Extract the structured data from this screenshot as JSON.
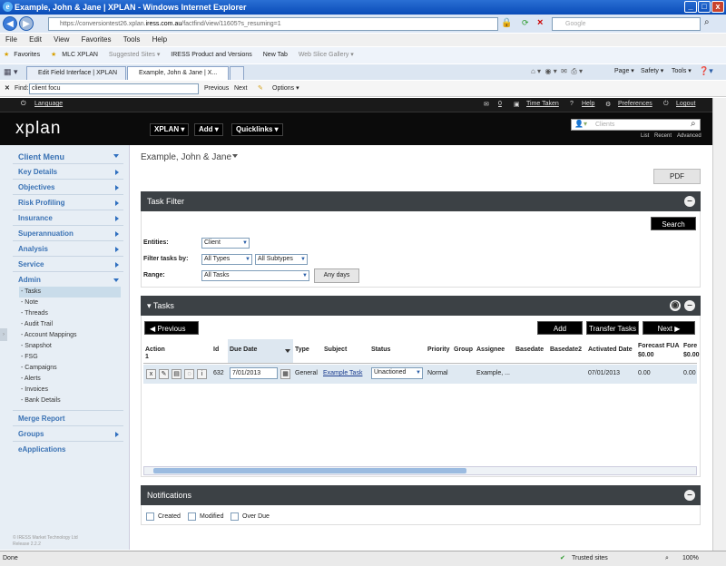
{
  "window": {
    "title": "Example, John & Jane | XPLAN - Windows Internet Explorer"
  },
  "browser": {
    "url_prefix": "https://conversiontest26.xplan.",
    "url_domain": "iress.com.au",
    "url_suffix": "/factfind/view/11605?s_resuming=1",
    "search_placeholder": "Google",
    "menu": [
      "File",
      "Edit",
      "View",
      "Favorites",
      "Tools",
      "Help"
    ],
    "favorites_label": "Favorites",
    "favorites": [
      "MLC XPLAN",
      "Suggested Sites ▾",
      "IRESS Product and Versions",
      "New Tab",
      "Web Slice Gallery ▾"
    ],
    "tabs": [
      "Edit Field Interface | XPLAN",
      "Example, John & Jane | X..."
    ],
    "toolbar_right": [
      "Page ▾",
      "Safety ▾",
      "Tools ▾"
    ],
    "find_label": "Find:",
    "find_value": "client focu",
    "find_prev": "Previous",
    "find_next": "Next",
    "find_options": "Options ▾",
    "status_left": "Done",
    "status_zone": "Trusted sites",
    "zoom": "100%"
  },
  "app": {
    "language": "Language",
    "messages_count": "0",
    "time_taken": "Time Taken",
    "help": "Help",
    "preferences": "Preferences",
    "logout": "Logout",
    "logo": "xplan",
    "top_menus": [
      "XPLAN ▾",
      "Add ▾",
      "Quicklinks ▾"
    ],
    "clients_placeholder": "Clients",
    "client_links": [
      "List",
      "Recent",
      "Advanced"
    ]
  },
  "sidebar": {
    "title": "Client Menu",
    "items": [
      "Key Details",
      "Objectives",
      "Risk Profiling",
      "Insurance",
      "Superannuation",
      "Analysis",
      "Service",
      "Admin"
    ],
    "admin_sub": [
      "- Tasks",
      "- Note",
      "- Threads",
      "- Audit Trail",
      "- Account Mappings",
      "- Snapshot",
      "- FSG",
      "- Campaigns",
      "- Alerts",
      "- Invoices",
      "- Bank Details"
    ],
    "bottom": [
      "Merge Report",
      "Groups",
      "eApplications"
    ],
    "copyright": "© IRESS Market Technology Ltd",
    "release": "Release 2.2.2"
  },
  "page": {
    "client_title": "Example, John & Jane",
    "pdf": "PDF",
    "task_filter": "Task Filter",
    "search": "Search",
    "entities_label": "Entities:",
    "entities_value": "Client",
    "filter_label": "Filter tasks by:",
    "filter_types": "All Types",
    "filter_subtypes": "All Subtypes",
    "range_label": "Range:",
    "range_value": "All Tasks",
    "any_days": "Any days",
    "tasks_title": "▾ Tasks",
    "previous": "Previous",
    "add": "Add",
    "transfer": "Transfer Tasks",
    "next": "Next",
    "columns": [
      "Action",
      "Id",
      "Due Date",
      "Type",
      "Subject",
      "Status",
      "Priority",
      "Group",
      "Assignee",
      "Basedate",
      "Basedate2",
      "Activated Date",
      "Forecast FUA",
      "Fore"
    ],
    "action_sub": "1",
    "forecast_sub": "$0.00",
    "fore_sub": "$0.00",
    "row": {
      "id": "632",
      "due": "7/01/2013",
      "type": "General",
      "subject": "Example Task",
      "status": "Unactioned",
      "priority": "Normal",
      "assignee": "Example, ...",
      "activated": "07/01/2013",
      "forecast": "0.00",
      "fore": "0.00"
    },
    "notifications": "Notifications",
    "notif_options": [
      "Created",
      "Modified",
      "Over Due"
    ]
  }
}
